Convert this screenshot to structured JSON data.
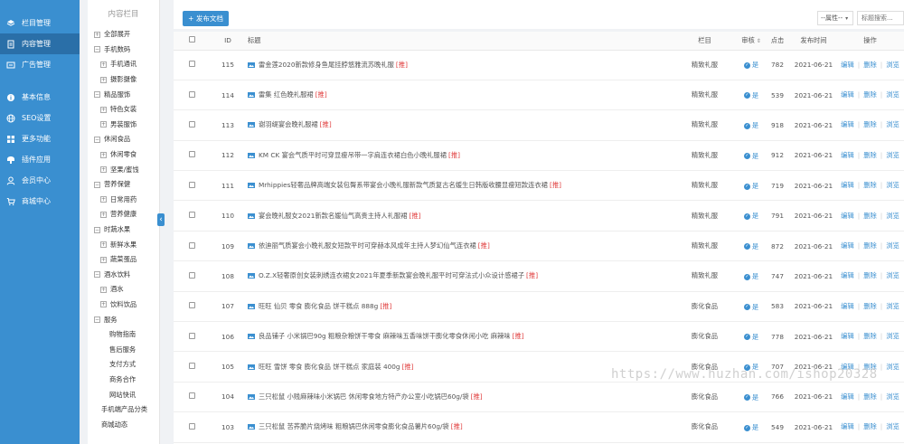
{
  "nav": {
    "items": [
      {
        "label": "栏目管理",
        "icon": "layers-icon",
        "active": false
      },
      {
        "label": "内容管理",
        "icon": "document-icon",
        "active": true
      },
      {
        "label": "广告管理",
        "icon": "ad-icon",
        "active": false
      },
      {
        "label": "基本信息",
        "icon": "info-icon",
        "active": false
      },
      {
        "label": "SEO设置",
        "icon": "globe-icon",
        "active": false
      },
      {
        "label": "更多功能",
        "icon": "grid-icon",
        "active": false
      },
      {
        "label": "插件应用",
        "icon": "plugin-icon",
        "active": false
      },
      {
        "label": "会员中心",
        "icon": "user-icon",
        "active": false
      },
      {
        "label": "商城中心",
        "icon": "cart-icon",
        "active": false
      }
    ]
  },
  "tree": {
    "title": "内容栏目",
    "rows": [
      {
        "label": "全部展开",
        "level": 0,
        "toggle": "+"
      },
      {
        "label": "手机数码",
        "level": 0,
        "toggle": "−"
      },
      {
        "label": "手机通讯",
        "level": 1,
        "toggle": "+"
      },
      {
        "label": "摄影摄像",
        "level": 1,
        "toggle": "+"
      },
      {
        "label": "精品服饰",
        "level": 0,
        "toggle": "−"
      },
      {
        "label": "特色女装",
        "level": 1,
        "toggle": "+"
      },
      {
        "label": "男装服饰",
        "level": 1,
        "toggle": "+"
      },
      {
        "label": "休闲食品",
        "level": 0,
        "toggle": "−"
      },
      {
        "label": "休闲零食",
        "level": 1,
        "toggle": "+"
      },
      {
        "label": "坚果/蜜饯",
        "level": 1,
        "toggle": "+"
      },
      {
        "label": "营养保健",
        "level": 0,
        "toggle": "−"
      },
      {
        "label": "日常用药",
        "level": 1,
        "toggle": "+"
      },
      {
        "label": "营养健康",
        "level": 1,
        "toggle": "+"
      },
      {
        "label": "时蔬水果",
        "level": 0,
        "toggle": "−"
      },
      {
        "label": "新鲜水果",
        "level": 1,
        "toggle": "+"
      },
      {
        "label": "蔬菜蛋品",
        "level": 1,
        "toggle": "+"
      },
      {
        "label": "酒水饮料",
        "level": 0,
        "toggle": "−"
      },
      {
        "label": "酒水",
        "level": 1,
        "toggle": "+"
      },
      {
        "label": "饮料饮品",
        "level": 1,
        "toggle": "+"
      },
      {
        "label": "服务",
        "level": 0,
        "toggle": "−"
      },
      {
        "label": "购物指南",
        "level": 2,
        "toggle": ""
      },
      {
        "label": "售后服务",
        "level": 2,
        "toggle": ""
      },
      {
        "label": "支付方式",
        "level": 2,
        "toggle": ""
      },
      {
        "label": "商务合作",
        "level": 2,
        "toggle": ""
      },
      {
        "label": "网站快讯",
        "level": 2,
        "toggle": ""
      },
      {
        "label": "手机端产品分类",
        "level": 3,
        "toggle": ""
      },
      {
        "label": "商城动态",
        "level": 3,
        "toggle": ""
      }
    ]
  },
  "toolbar": {
    "post_label": "+ 发布文档",
    "attr_label": "--属性--",
    "search_placeholder": "标题搜索..."
  },
  "table": {
    "headers": {
      "id": "ID",
      "title": "标题",
      "column": "栏目",
      "audit": "审核",
      "clicks": "点击",
      "time": "发布时间",
      "ops": "操作"
    },
    "audit_label": "是",
    "ops": {
      "edit": "编辑",
      "delete": "删除",
      "view": "浏览"
    },
    "rows": [
      {
        "id": "115",
        "title": "雷金莲2020新款修身鱼尾挂脖悠雅流苏晚礼服",
        "tag": "[推]",
        "column": "精致礼服",
        "clicks": "782",
        "time": "2021-06-21"
      },
      {
        "id": "114",
        "title": "雷集 红色晚礼服裙",
        "tag": "[推]",
        "column": "精致礼服",
        "clicks": "539",
        "time": "2021-06-21"
      },
      {
        "id": "113",
        "title": "谢羽缇宴会晚礼服裙",
        "tag": "[推]",
        "column": "精致礼服",
        "clicks": "918",
        "time": "2021-06-21"
      },
      {
        "id": "112",
        "title": "KM CK 宴会气质平时可穿显瘦吊带一字肩连衣裙白色小晚礼服裙",
        "tag": "[推]",
        "column": "精致礼服",
        "clicks": "912",
        "time": "2021-06-21"
      },
      {
        "id": "111",
        "title": "Mrhippies轻奢品牌高端女装包臀系带宴会小晚礼服新款气质复古名媛生日韩版收腰显瘦短款连衣裙",
        "tag": "[推]",
        "column": "精致礼服",
        "clicks": "719",
        "time": "2021-06-21"
      },
      {
        "id": "110",
        "title": "宴会晚礼服女2021新款名媛仙气高贵主持人礼服裙",
        "tag": "[推]",
        "column": "精致礼服",
        "clicks": "791",
        "time": "2021-06-21"
      },
      {
        "id": "109",
        "title": "依迪丽气质宴会小晚礼服女短款平时可穿赫本风成年主持人梦幻仙气连衣裙",
        "tag": "[推]",
        "column": "精致礼服",
        "clicks": "872",
        "time": "2021-06-21"
      },
      {
        "id": "108",
        "title": "O.Z.X轻奢原创女装刺绣连衣裙女2021年夏季新款宴会晚礼服平时可穿法式小众设计感裙子",
        "tag": "[推]",
        "column": "精致礼服",
        "clicks": "747",
        "time": "2021-06-21"
      },
      {
        "id": "107",
        "title": "旺旺 仙贝 零食 膨化食品 饼干糕点 888g",
        "tag": "[推]",
        "column": "膨化食品",
        "clicks": "583",
        "time": "2021-06-21"
      },
      {
        "id": "106",
        "title": "良品铺子 小米锅巴90g 粗粮杂粮饼干零食 麻辣味五香味饼干膨化零食休闲小吃 麻辣味",
        "tag": "[推]",
        "column": "膨化食品",
        "clicks": "778",
        "time": "2021-06-21"
      },
      {
        "id": "105",
        "title": "旺旺 雪饼 零食 膨化食品 饼干糕点 家庭装 400g",
        "tag": "[推]",
        "column": "膨化食品",
        "clicks": "707",
        "time": "2021-06-21"
      },
      {
        "id": "104",
        "title": "三只松鼠 小贱麻辣味小米锅巴 休闲零食地方特产办公室小吃锅巴60g/袋",
        "tag": "[推]",
        "column": "膨化食品",
        "clicks": "766",
        "time": "2021-06-21"
      },
      {
        "id": "103",
        "title": "三只松鼠 苦荞脆片烧烤味 粗粮锅巴休闲零食膨化食品薯片60g/袋",
        "tag": "[推]",
        "column": "膨化食品",
        "clicks": "549",
        "time": "2021-06-21"
      }
    ]
  },
  "watermark": "https://www.huzhan.com/ishop20328",
  "colors": {
    "accent": "#3a8fd0",
    "tag": "#e03b3b"
  }
}
